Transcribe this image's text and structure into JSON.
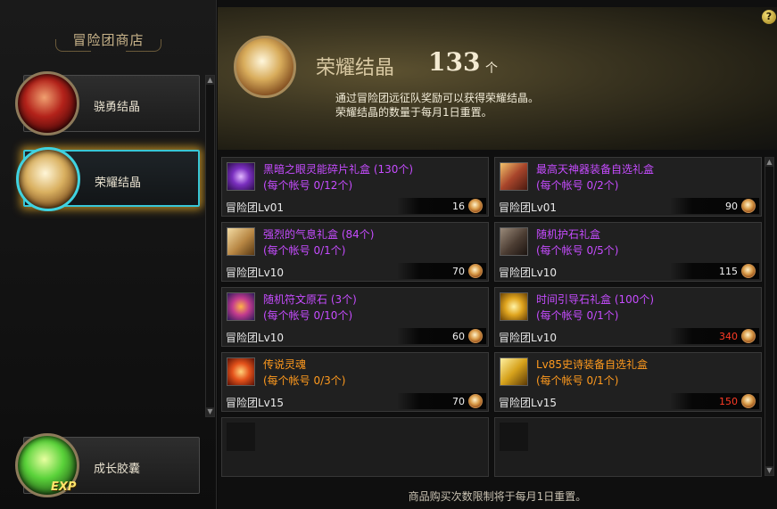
{
  "sidebar": {
    "title": "冒险团商店",
    "items": [
      {
        "label": "骁勇结晶",
        "icon": "valor-crystal-icon"
      },
      {
        "label": "荣耀结晶",
        "icon": "glory-crystal-icon"
      },
      {
        "label": "成长胶囊",
        "icon": "growth-capsule-icon",
        "badge": "EXP"
      }
    ]
  },
  "header": {
    "currency_name": "荣耀结晶",
    "count": "133",
    "unit": "个",
    "desc_line1": "通过冒险团远征队奖励可以获得荣耀结晶。",
    "desc_line2": "荣耀结晶的数量于每月1日重置。",
    "help": "?"
  },
  "items": [
    {
      "name": "黑暗之眼灵能碎片礼盒 (130个)",
      "limit": "(每个帐号 0/12个)",
      "level": "冒险团Lv01",
      "price": "16",
      "name_color": "purple",
      "price_color": "white"
    },
    {
      "name": "最高天神器装备自选礼盒",
      "limit": "(每个帐号 0/2个)",
      "level": "冒险团Lv01",
      "price": "90",
      "name_color": "purple",
      "price_color": "white"
    },
    {
      "name": "强烈的气息礼盒 (84个)",
      "limit": "(每个帐号 0/1个)",
      "level": "冒险团Lv10",
      "price": "70",
      "name_color": "purple",
      "price_color": "white"
    },
    {
      "name": "随机护石礼盒",
      "limit": "(每个帐号 0/5个)",
      "level": "冒险团Lv10",
      "price": "115",
      "name_color": "purple",
      "price_color": "white"
    },
    {
      "name": "随机符文原石 (3个)",
      "limit": "(每个帐号 0/10个)",
      "level": "冒险团Lv10",
      "price": "60",
      "name_color": "purple",
      "price_color": "white"
    },
    {
      "name": "时间引导石礼盒 (100个)",
      "limit": "(每个帐号 0/1个)",
      "level": "冒险团Lv10",
      "price": "340",
      "name_color": "purple",
      "price_color": "red"
    },
    {
      "name": "传说灵魂",
      "limit": "(每个帐号 0/3个)",
      "level": "冒险团Lv15",
      "price": "70",
      "name_color": "orange",
      "price_color": "white"
    },
    {
      "name": "Lv85史诗装备自选礼盒",
      "limit": "(每个帐号 0/1个)",
      "level": "冒险团Lv15",
      "price": "150",
      "name_color": "orange",
      "price_color": "red"
    }
  ],
  "footer": "商品购买次数限制将于每月1日重置。"
}
